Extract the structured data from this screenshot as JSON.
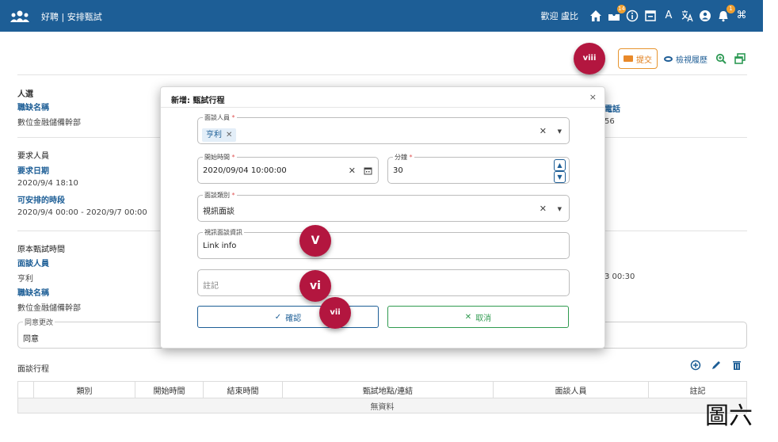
{
  "header": {
    "brand": "好聘 | 安排甄試",
    "welcome": "歡迎 盧比",
    "icons": [
      {
        "name": "home-icon",
        "glyph": "⌂",
        "badge": ""
      },
      {
        "name": "inbox-icon",
        "glyph": "✉",
        "badge": "14"
      },
      {
        "name": "info-icon",
        "glyph": "ⓘ",
        "badge": ""
      },
      {
        "name": "window-icon",
        "glyph": "❐",
        "badge": ""
      },
      {
        "name": "font-icon",
        "glyph": "A",
        "badge": ""
      },
      {
        "name": "translate-icon",
        "glyph": "文",
        "badge": ""
      },
      {
        "name": "user-icon",
        "glyph": "●",
        "badge": ""
      },
      {
        "name": "bell-icon",
        "glyph": "♪",
        "badge": "1"
      },
      {
        "name": "command-icon",
        "glyph": "⌘",
        "badge": ""
      }
    ]
  },
  "toolbar": {
    "submit_label": "提交",
    "history_label": "檢視履歷"
  },
  "page": {
    "section_candidate": "人選",
    "job_name_label": "職缺名稱",
    "job_name_value": "數位金融儲備幹部",
    "phone_label": "電話",
    "phone_value_partial": "56",
    "requester_label": "要求人員",
    "request_date_label": "要求日期",
    "request_date_value": "2020/9/4 18:10",
    "available_slot_label": "可安排的時段",
    "available_slot_value": "2020/9/4 00:00 - 2020/9/7 00:00",
    "original_time_label": "原本甄試時間",
    "interviewer_label": "面談人員",
    "interviewer_value": "亨利",
    "job_name_label2": "職缺名稱",
    "job_name_value2": "數位金融儲備幹部",
    "original_time_partial": "3 00:30",
    "agree_change_legend": "同意更改",
    "agree_change_value": "同意",
    "schedule_title": "面談行程"
  },
  "table": {
    "columns": [
      "",
      "類別",
      "開始時間",
      "結束時間",
      "甄試地點/連結",
      "面談人員",
      "註記"
    ],
    "empty_text": "無資料"
  },
  "modal": {
    "title": "新增: 甄試行程",
    "close": "×",
    "interviewer_legend": "面談人員",
    "interviewer_chip": "亨利",
    "start_legend": "開始時間",
    "start_value": "2020/09/04 10:00:00",
    "minutes_legend": "分鐘",
    "minutes_value": "30",
    "type_legend": "面談類別",
    "type_value": "視訊面談",
    "video_legend": "視訊面談資訊",
    "video_value": "Link info",
    "note_placeholder": "註記",
    "confirm_label": "確認",
    "cancel_label": "取消",
    "required_mark": "*"
  },
  "markers": {
    "v": "V",
    "vi": "vi",
    "vii": "vii",
    "viii": "viii"
  },
  "caption": "圖六",
  "colors": {
    "header_bg": "#1d5e96",
    "marker": "#b3163f",
    "submit_orange": "#e07b14",
    "cancel_green": "#2f9a4f"
  }
}
